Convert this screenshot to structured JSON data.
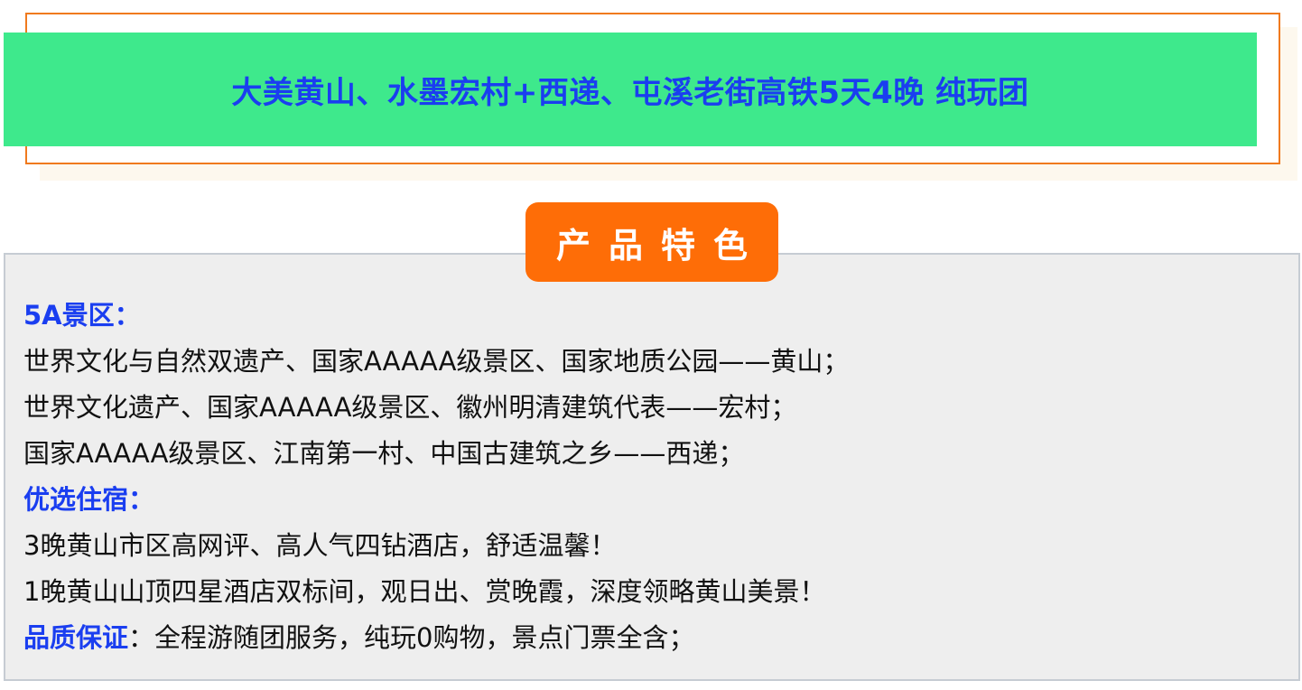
{
  "header": {
    "title": "大美黄山、水墨宏村+西递、屯溪老街高铁5天4晚 纯玩团"
  },
  "features": {
    "badge": "产品特色",
    "sections": {
      "scenic": {
        "heading": "5A景区：",
        "lines": [
          "世界文化与自然双遗产、国家AAAAA级景区、国家地质公园——黄山；",
          "世界文化遗产、国家AAAAA级景区、徽州明清建筑代表——宏村；",
          "国家AAAAA级景区、江南第一村、中国古建筑之乡——西递；"
        ]
      },
      "lodging": {
        "heading": "优选住宿：",
        "lines": [
          "3晚黄山市区高网评、高人气四钻酒店，舒适温馨！",
          "1晚黄山山顶四星酒店双标间，观日出、赏晚霞，深度领略黄山美景！"
        ]
      },
      "quality": {
        "heading": "品质保证",
        "text": "：全程游随团服务，纯玩0购物，景点门票全含；"
      }
    }
  },
  "colors": {
    "title_bar": "#3ee98c",
    "title_text": "#1a3ef0",
    "frame_border": "#f07a1e",
    "badge_bg": "#fe6d07",
    "box_bg": "#eeeeee",
    "heading_blue": "#1a3ef0"
  }
}
